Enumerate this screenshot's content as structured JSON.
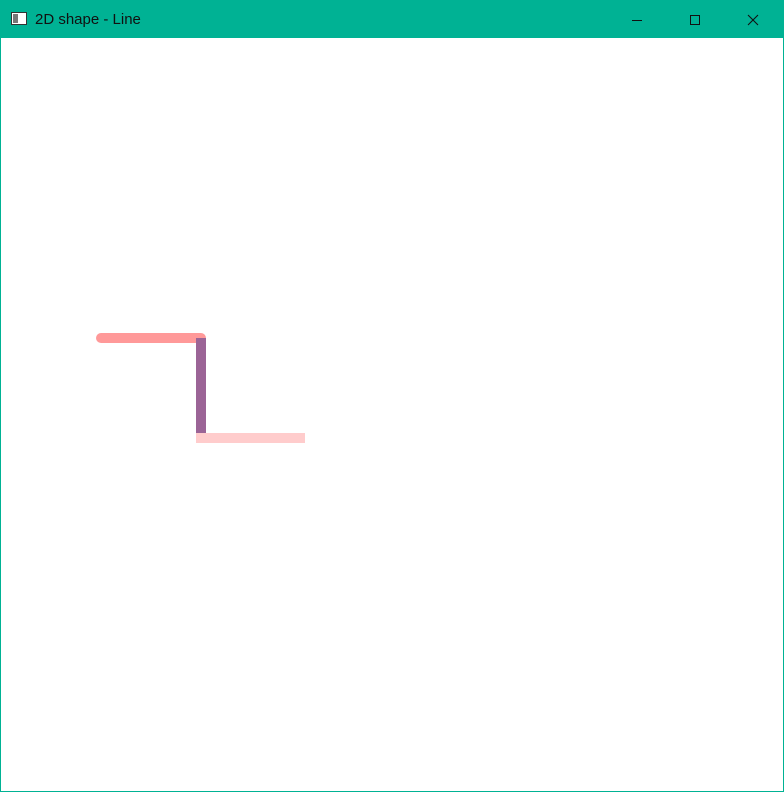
{
  "window": {
    "title": "2D shape - Line",
    "accent_color": "#00b294",
    "icons": {
      "app": "window-app-icon",
      "minimize": "minimize-icon",
      "maximize": "maximize-icon",
      "close": "close-icon"
    }
  },
  "shapes": [
    {
      "type": "line",
      "color": "#ff9999",
      "cap": "round"
    },
    {
      "type": "line",
      "color": "#9b6496",
      "cap": "butt"
    },
    {
      "type": "line",
      "color": "#ffcccc",
      "cap": "butt"
    }
  ]
}
